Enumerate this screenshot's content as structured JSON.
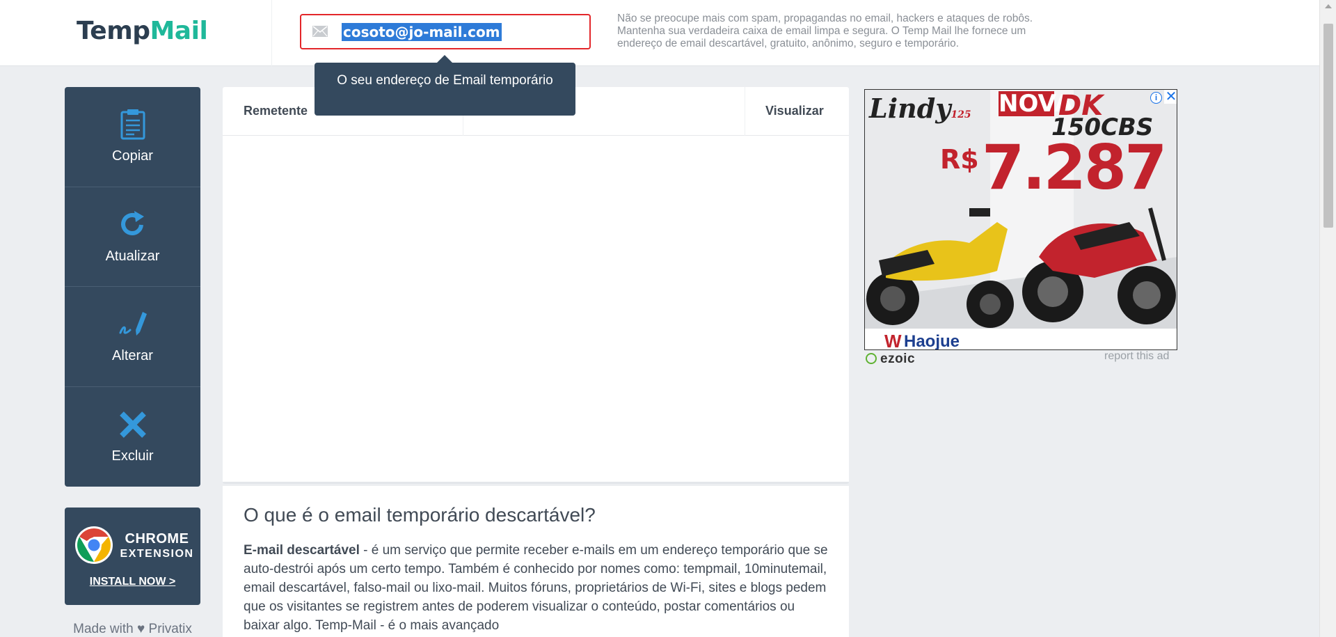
{
  "header": {
    "logo_temp": "Temp",
    "logo_mail": "Mail",
    "email": "cosoto@jo-mail.com",
    "description": "Não se preocupe mais com spam, propagandas no email, hackers e ataques de robôs. Mantenha sua verdadeira caixa de email limpa e segura. O Temp Mail lhe fornece um endereço de email descartável, gratuito, anônimo, seguro e temporário."
  },
  "tooltip": {
    "text": "O seu endereço de Email temporário"
  },
  "sidebar": {
    "items": [
      {
        "label": "Copiar",
        "icon": "clipboard-icon"
      },
      {
        "label": "Atualizar",
        "icon": "refresh-icon"
      },
      {
        "label": "Alterar",
        "icon": "edit-pen-icon"
      },
      {
        "label": "Excluir",
        "icon": "delete-x-icon"
      }
    ],
    "chrome": {
      "title": "CHROME",
      "subtitle": "EXTENSION",
      "cta": "INSTALL NOW >"
    },
    "made_with": "Made with ♥ Privatix"
  },
  "inbox": {
    "col_sender": "Remetente",
    "col_view": "Visualizar"
  },
  "about": {
    "title": "O que é o email temporário descartável?",
    "bold_lead": "E-mail descartável",
    "body": " - é um serviço que permite receber e-mails em um endereço temporário que se auto-destrói após um certo tempo. Também é conhecido por nomes como: tempmail, 10minutemail, email descartável, falso-mail ou lixo-mail. Muitos fóruns, proprietários de Wi-Fi, sites e blogs pedem que os visitantes se registrem antes de poderem visualizar o conteúdo, postar comentários ou baixar algo. Temp-Mail - é o mais avançado"
  },
  "ad": {
    "brand": "Lindy",
    "brand_sub": "125",
    "nova": "NOVA",
    "model": "DK",
    "model_sub": "150CBS",
    "currency": "R$",
    "price": "7.287",
    "maker": "Haojue",
    "info_icon": "info-icon",
    "close_icon": "close-icon",
    "network": "ezoic",
    "report": "report this ad"
  },
  "colors": {
    "sidebar_bg": "#34495e",
    "accent_blue": "#3498db",
    "logo_green": "#1fb89a",
    "email_border": "#e3262a"
  }
}
